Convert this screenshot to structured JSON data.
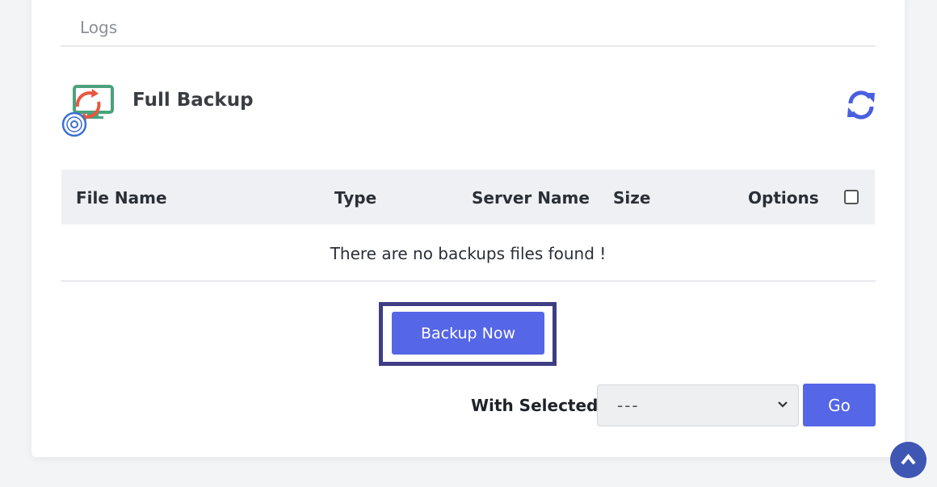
{
  "tabs": [
    {
      "label": "Logs"
    }
  ],
  "section": {
    "title": "Full Backup",
    "icon": "backup-monitor-icon",
    "refresh_icon": "refresh-icon"
  },
  "table": {
    "columns": [
      "File Name",
      "Type",
      "Server Name",
      "Size",
      "Options"
    ],
    "empty_message": "There are no backups files found !"
  },
  "actions": {
    "backup_now": "Backup Now",
    "with_selected_label": "With Selected:",
    "with_selected_value": "---",
    "go": "Go"
  },
  "colors": {
    "primary": "#5566e6",
    "frame": "#3f3d84",
    "scroll_top": "#3f57b3"
  }
}
